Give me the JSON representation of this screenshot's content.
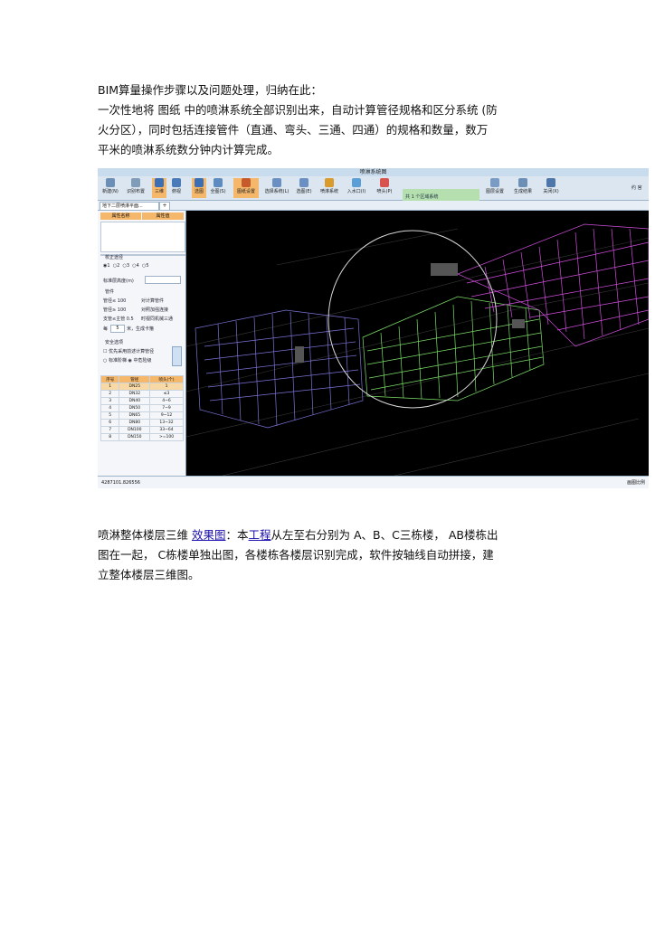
{
  "intro": {
    "line1": "BIM算量操作步骤以及问题处理，归纳在此：",
    "line2": "一次性地将  图纸 中的喷淋系统全部识别出来，自动计算管径规格和区分系统        (防",
    "line3": "火分区），同时包括连接管件（直通、弯头、三通、四通）的规格和数量，数万",
    "line4": "平米的喷淋系统数分钟内计算完成。"
  },
  "screenshot": {
    "window_title": "喷淋系统图",
    "ribbon_buttons": [
      {
        "label": "新建(N)"
      },
      {
        "label": "识别布置"
      },
      {
        "label": "三维"
      },
      {
        "label": "俯视"
      },
      {
        "label": "选图"
      },
      {
        "label": "全图(S)"
      },
      {
        "label": "图纸设置"
      },
      {
        "label": "选择系统(L)"
      },
      {
        "label": "选图(E)"
      },
      {
        "label": "喷淋系统"
      },
      {
        "label": "入水口(I)"
      },
      {
        "label": "喷头(P)"
      },
      {
        "label": "图层设置"
      },
      {
        "label": "生成结果"
      },
      {
        "label": "关闭(X)"
      }
    ],
    "message": "共 1 个区域系统",
    "right_edge_text": "约 官",
    "tab_label": "地下二层喷淋平面...",
    "tab_add": "+",
    "panel": {
      "col_name": "属性名称",
      "col_value": "属性值",
      "section_correction": "校正途径",
      "radio_options": [
        "1",
        "2",
        "3",
        "4",
        "5"
      ],
      "elevation_label": "标准层高度(m)",
      "pipe_section": "管件",
      "pipe_row1": "管径≤ 100",
      "pipe_row1_opt": "对计算管件",
      "pipe_row2": "管径≥ 100",
      "pipe_row2_opt": "对照加强连接",
      "branch_row": "支管≤主管 0.5",
      "branch_opt": "时视同机械三通",
      "step_label": "每",
      "step_value": "5",
      "step_suffix": "米，生成卡箍",
      "safety_section": "安全选项",
      "safety_check": "优先采用前述计算管径",
      "safety_radio1": "标准阶梯",
      "safety_radio2": "中危险级",
      "table_headers": [
        "序号",
        "管径",
        "喷头(个)"
      ],
      "table_rows": [
        [
          "1",
          "DN25",
          "1"
        ],
        [
          "2",
          "DN32",
          "≤3"
        ],
        [
          "3",
          "DN40",
          "4~6"
        ],
        [
          "4",
          "DN50",
          "7~9"
        ],
        [
          "5",
          "DN65",
          "9~12"
        ],
        [
          "6",
          "DN80",
          "13~32"
        ],
        [
          "7",
          "DN100",
          "33~64"
        ],
        [
          "8",
          "DN150",
          ">=100"
        ]
      ]
    },
    "status_left": "4287101.826556",
    "status_right": "画图比例"
  },
  "outro": {
    "line1_prefix": "喷淋整体楼层三维  ",
    "link1": "效果图",
    "line1_mid": "：本",
    "link2": "工程",
    "line1_suffix": "从左至右分别为    A、B、C三栋楼，  AB楼栋出",
    "line2": "图在一起，  C栋楼单独出图，各楼栋各楼层识别完成，软件按轴线自动拼接，建",
    "line3": "立整体楼层三维图。"
  },
  "colors": {
    "building_a": "#7a74d8",
    "building_b": "#7de06a",
    "building_c": "#d34ee0",
    "background": "#000000",
    "highlight": "#f5b76a"
  }
}
